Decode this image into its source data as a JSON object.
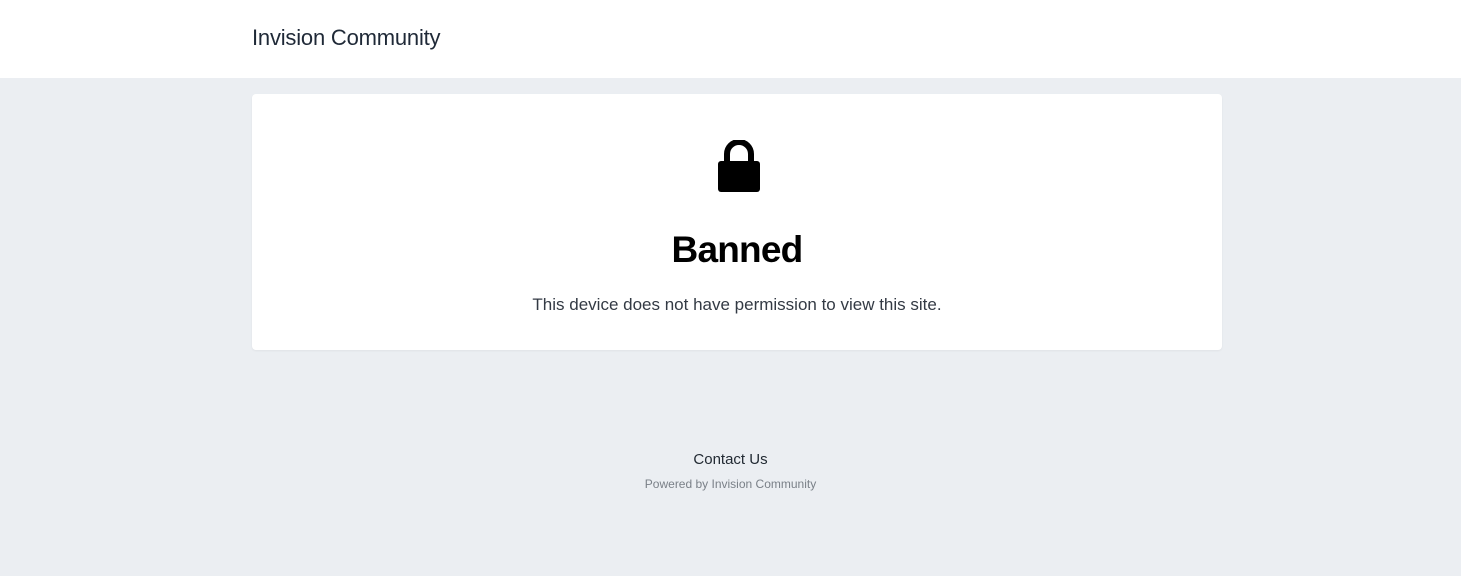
{
  "header": {
    "site_title": "Invision Community"
  },
  "error": {
    "icon": "lock-icon",
    "title": "Banned",
    "message": "This device does not have permission to view this site."
  },
  "footer": {
    "contact_link": "Contact Us",
    "powered_by": "Powered by Invision Community"
  },
  "colors": {
    "page_background": "#ebeef2",
    "card_background": "#ffffff",
    "title_color": "#000000"
  }
}
